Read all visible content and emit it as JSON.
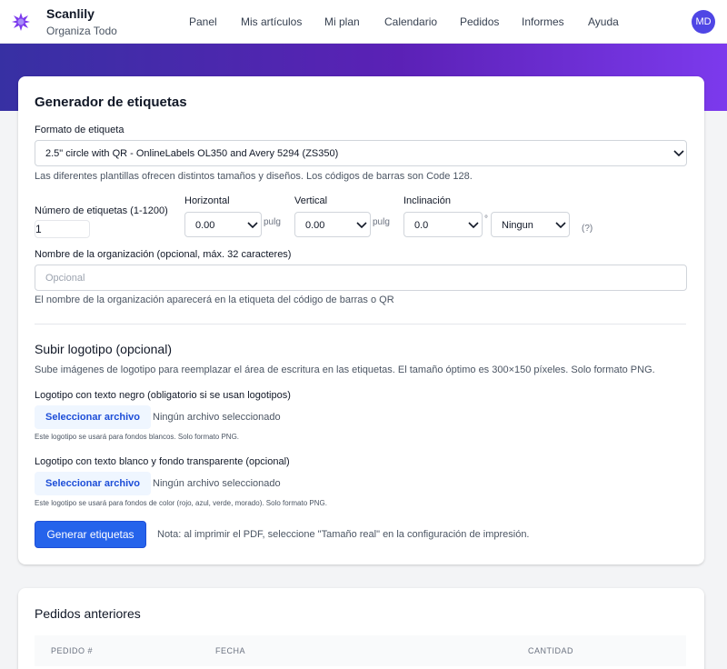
{
  "brand": {
    "name": "Scanlily",
    "tagline": "Organiza Todo",
    "logo_icon": "purple-star-icon",
    "logo_color": "#7c3aed"
  },
  "nav": [
    "Panel",
    "Mis artículos",
    "Mi plan",
    "Calendario",
    "Pedidos",
    "Informes",
    "Ayuda"
  ],
  "user": {
    "initials": "MD",
    "avatar_color": "#4f46e5"
  },
  "header_gradient": [
    "#3730a3",
    "#7c3aed"
  ],
  "label_generator": {
    "title": "Generador de etiquetas",
    "format_label": "Formato de etiqueta",
    "format_value": "2.5\" circle with QR - OnlineLabels OL350 and Avery 5294 (ZS350)",
    "format_help": "Las diferentes plantillas ofrecen distintos tamaños y diseños. Los códigos de barras son Code 128.",
    "count_label": "Número de etiquetas (1-1200)",
    "count_value": "1",
    "horizontal_label": "Horizontal",
    "horizontal_value": "0.00",
    "horizontal_unit": "pulg",
    "vertical_label": "Vertical",
    "vertical_value": "0.00",
    "vertical_unit": "pulg",
    "tilt_label": "Inclinación",
    "tilt_value": "0.0",
    "tilt_unit": "°",
    "tilt_mode_value": "Ningun",
    "tilt_help_link": "(?)",
    "org_label": "Nombre de la organización (opcional, máx. 32 caracteres)",
    "org_placeholder": "Opcional",
    "org_help": "El nombre de la organización aparecerá en la etiqueta del código de barras o QR"
  },
  "logo_upload": {
    "title": "Subir logotipo (opcional)",
    "description": "Sube imágenes de logotipo para reemplazar el área de escritura en las etiquetas. El tamaño óptimo es 300×150 píxeles. Solo formato PNG.",
    "black_label": "Logotipo con texto negro (obligatorio si se usan logotipos)",
    "black_button": "Seleccionar archivo",
    "black_status": "Ningún archivo seleccionado",
    "black_help": "Este logotipo se usará para fondos blancos. Solo formato PNG.",
    "white_label": "Logotipo con texto blanco y fondo transparente (opcional)",
    "white_button": "Seleccionar archivo",
    "white_status": "Ningún archivo seleccionado",
    "white_help": "Este logotipo se usará para fondos de color (rojo, azul, verde, morado). Solo formato PNG."
  },
  "generate": {
    "button": "Generar etiquetas",
    "note": "Nota: al imprimir el PDF, seleccione \"Tamaño real\" en la configuración de impresión.",
    "button_color": "#2563eb"
  },
  "previous_orders": {
    "title": "Pedidos anteriores",
    "columns": [
      "PEDIDO #",
      "FECHA",
      "CANTIDAD"
    ]
  }
}
